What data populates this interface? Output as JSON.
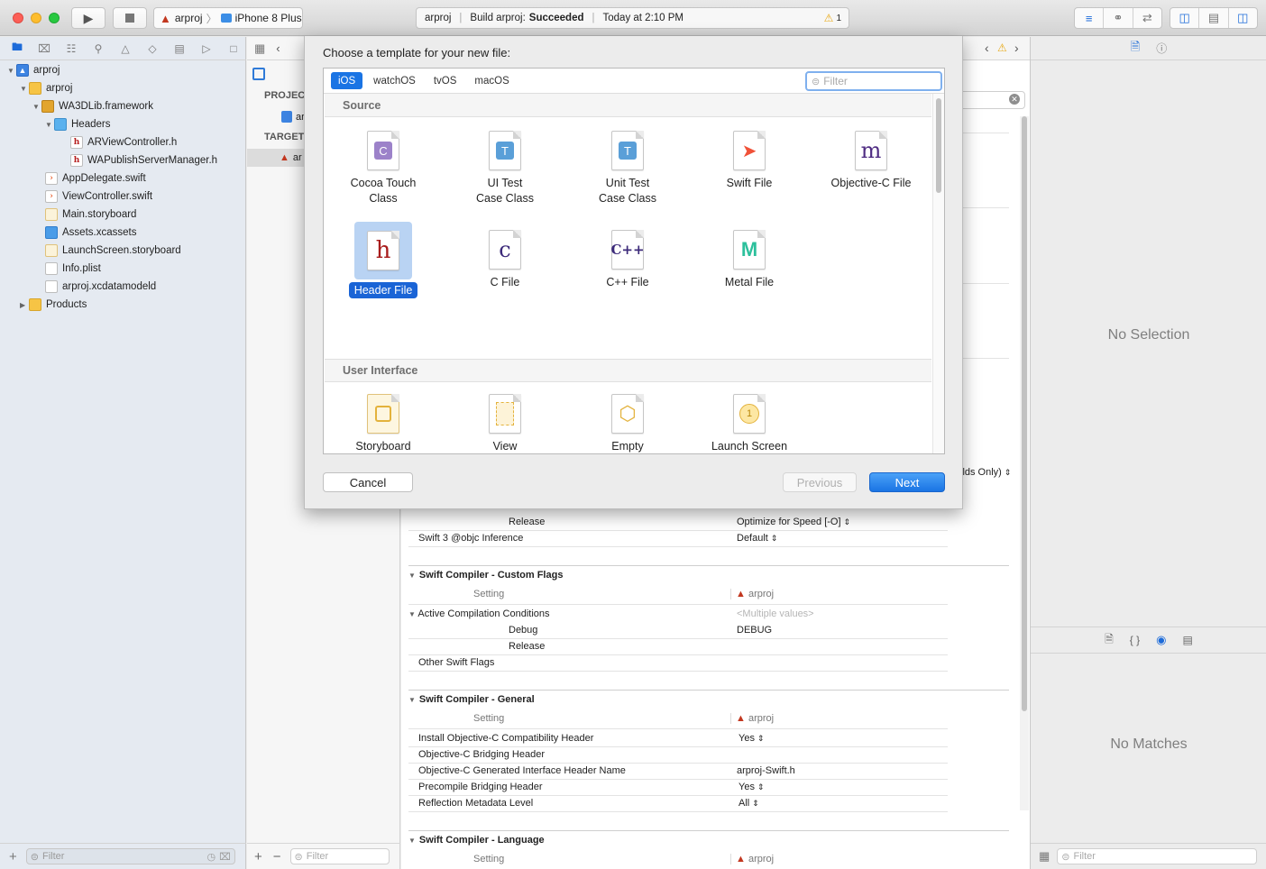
{
  "toolbar": {
    "scheme_project": "arproj",
    "scheme_device": "iPhone 8 Plus",
    "status_project": "arproj",
    "status_build": "Build arproj:",
    "status_result": "Succeeded",
    "status_time": "Today at 2:10 PM",
    "warning_count": "1"
  },
  "navigator": {
    "items": [
      {
        "label": "arproj"
      },
      {
        "label": "arproj"
      },
      {
        "label": "WA3DLib.framework"
      },
      {
        "label": "Headers"
      },
      {
        "label": "ARViewController.h"
      },
      {
        "label": "WAPublishServerManager.h"
      },
      {
        "label": "AppDelegate.swift"
      },
      {
        "label": "ViewController.swift"
      },
      {
        "label": "Main.storyboard"
      },
      {
        "label": "Assets.xcassets"
      },
      {
        "label": "LaunchScreen.storyboard"
      },
      {
        "label": "Info.plist"
      },
      {
        "label": "arproj.xcdatamodeld"
      },
      {
        "label": "Products"
      }
    ],
    "filter_placeholder": "Filter"
  },
  "projlist": {
    "project_header": "PROJEC",
    "targets_header": "TARGET",
    "project_item": "ar",
    "target_item": "ar",
    "filter_placeholder": "Filter"
  },
  "editor": {
    "partial_value": "ilds Only)",
    "rows_top": [
      {
        "name": "Release",
        "value": "Optimize for Speed [-O]"
      },
      {
        "name": "Swift 3 @objc Inference",
        "value": "Default"
      }
    ],
    "sections": [
      {
        "title": "Swift Compiler - Custom Flags",
        "setting_label": "Setting",
        "target_label": "arproj",
        "rows": [
          {
            "name": "Active Compilation Conditions",
            "value": "<Multiple values>"
          },
          {
            "name": "Debug",
            "value": "DEBUG"
          },
          {
            "name": "Release",
            "value": ""
          },
          {
            "name": "Other Swift Flags",
            "value": ""
          }
        ]
      },
      {
        "title": "Swift Compiler - General",
        "setting_label": "Setting",
        "target_label": "arproj",
        "rows": [
          {
            "name": "Install Objective-C Compatibility Header",
            "value": "Yes"
          },
          {
            "name": "Objective-C Bridging Header",
            "value": ""
          },
          {
            "name": "Objective-C Generated Interface Header Name",
            "value": "arproj-Swift.h"
          },
          {
            "name": "Precompile Bridging Header",
            "value": "Yes"
          },
          {
            "name": "Reflection Metadata Level",
            "value": "All"
          }
        ]
      },
      {
        "title": "Swift Compiler - Language",
        "setting_label": "Setting",
        "target_label": "arproj",
        "rows": []
      }
    ]
  },
  "inspector": {
    "no_selection": "No Selection",
    "no_matches": "No Matches",
    "filter_placeholder": "Filter"
  },
  "dialog": {
    "title": "Choose a template for your new file:",
    "platforms": [
      "iOS",
      "watchOS",
      "tvOS",
      "macOS"
    ],
    "selected_platform": "iOS",
    "filter_placeholder": "Filter",
    "categories": [
      {
        "name": "Source",
        "templates": [
          {
            "label": "Cocoa Touch\nClass",
            "glyph": "C"
          },
          {
            "label": "UI Test\nCase Class",
            "glyph": "T"
          },
          {
            "label": "Unit Test\nCase Class",
            "glyph": "T"
          },
          {
            "label": "Swift File",
            "glyph": "swift"
          },
          {
            "label": "Objective-C File",
            "glyph": "m"
          },
          {
            "label": "Header File",
            "glyph": "h",
            "selected": true
          },
          {
            "label": "C File",
            "glyph": "c"
          },
          {
            "label": "C++ File",
            "glyph": "C++"
          },
          {
            "label": "Metal File",
            "glyph": "M"
          }
        ]
      },
      {
        "name": "User Interface",
        "templates": [
          {
            "label": "Storyboard",
            "glyph": "storyboard"
          },
          {
            "label": "View",
            "glyph": "view"
          },
          {
            "label": "Empty",
            "glyph": "box"
          },
          {
            "label": "Launch Screen",
            "glyph": "1"
          }
        ]
      }
    ],
    "cancel_label": "Cancel",
    "previous_label": "Previous",
    "next_label": "Next"
  },
  "colors": {
    "accent": "#1a74e4",
    "selection": "#1a64d6",
    "warning": "#e8a917"
  }
}
